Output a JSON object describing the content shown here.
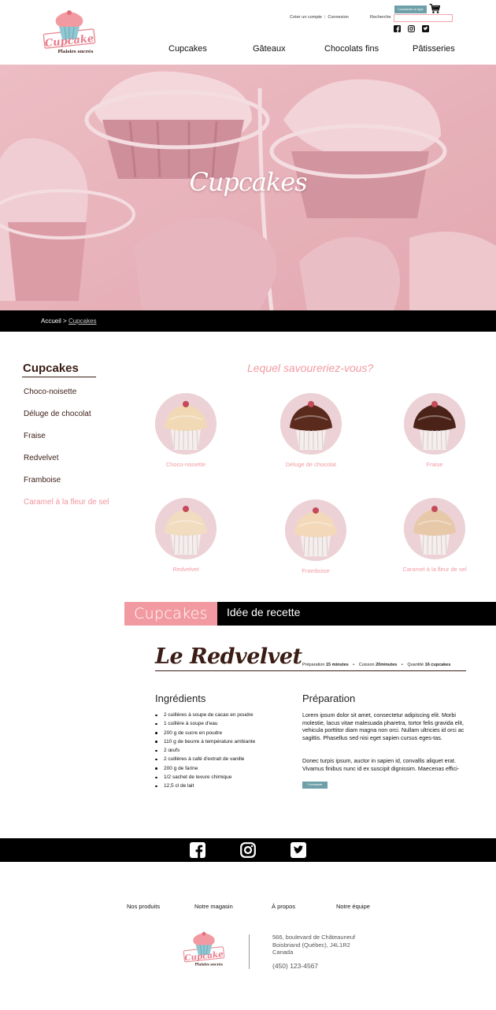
{
  "header": {
    "logo_text": "Cupcake",
    "logo_subtext": "Plaisirs sucrés",
    "create_account": "Créer un compte",
    "login": "Connexion",
    "search_label": "Recherche",
    "search_placeholder": "",
    "order_button": "Commander en ligne",
    "social_icons": [
      "facebook-icon",
      "instagram-icon",
      "twitter-icon"
    ],
    "nav": [
      "Cupcakes",
      "Gâteaux",
      "Chocolats fins",
      "Pâtisseries"
    ]
  },
  "hero": {
    "title": "Cupcakes"
  },
  "breadcrumb": {
    "home": "Accueil",
    "separator": ">",
    "current": "Cupcakes"
  },
  "sidebar": {
    "title": "Cupcakes",
    "items": [
      "Choco-noisette",
      "Déluge de chocolat",
      "Fraise",
      "Redvelvet",
      "Framboise",
      "Caramel à la fleur de sel"
    ],
    "active_index": 5
  },
  "products": {
    "question": "Lequel savoureriez-vous?",
    "items": [
      {
        "label": "Choco-noisette",
        "frosting": "#f1d9b5"
      },
      {
        "label": "Déluge de chocolat",
        "frosting": "#5a2a1c"
      },
      {
        "label": "Fraise",
        "frosting": "#4b2218"
      },
      {
        "label": "Redvelvet",
        "frosting": "#f2dcc0"
      },
      {
        "label": "Framboise",
        "frosting": "#f3d9b9"
      },
      {
        "label": "Caramel à la fleur de sel",
        "frosting": "#e7c8a8"
      }
    ]
  },
  "recipe_bar": {
    "tab": "Cupcakes",
    "title": "Idée de recette"
  },
  "recipe": {
    "title": "Le Redvelvet",
    "prep_label": "Préparation",
    "prep_value": "15 minutes",
    "cook_label": "Cuisson",
    "cook_value": "20minutes",
    "qty_label": "Quantité",
    "qty_value": "16 cupcakes",
    "ingredients_title": "Ingrédients",
    "ingredients": [
      "2 cuillères à soupe de cacao en poudre",
      "1 cuillère à soupe d'eau",
      "200 g de sucre en poudre",
      "110 g de beurre à température ambiante",
      "2 œufs",
      "2 cuillères à café d'extrait de vanille",
      "200 g de farine",
      "1/2 sachet de levure chimique",
      "12,5 cl de lait"
    ],
    "preparation_title": "Préparation",
    "preparation_p1": "Lorem ipsum dolor sit amet, consectetur adipiscing elit. Morbi molestie, lacus vitae malesuada pharetra, tortor felis gravida elit, vehicula porttitor diam magna non orci. Nullam ultricies id orci ac sagittis. Phasellus sed nisi eget sapien cursus eges-tas.",
    "preparation_p2": "Donec turpis ipsum, auctor in sapien id, convallis aliquet erat. Vivamus finibus nunc id ex suscipit dignissim. Maecenas effici-",
    "button": "Commander"
  },
  "footer": {
    "social_icons": [
      "facebook-icon",
      "instagram-icon",
      "twitter-icon"
    ],
    "nav": [
      "Nos produits",
      "Notre magasin",
      "À propos",
      "Notre équipe"
    ],
    "logo_text": "Cupcake",
    "logo_subtext": "Plaisirs sucrés",
    "address_line1": "566, boulevard de Châteauneuf",
    "address_line2": "Boisbriand (Québec), J4L1R2",
    "address_line3": "Canada",
    "phone": "(450) 123-4567"
  },
  "colors": {
    "accent_pink": "#f29aa2",
    "dark_brown": "#3b1d15",
    "button_teal": "#6f9fa8",
    "bar_black": "#000000"
  }
}
